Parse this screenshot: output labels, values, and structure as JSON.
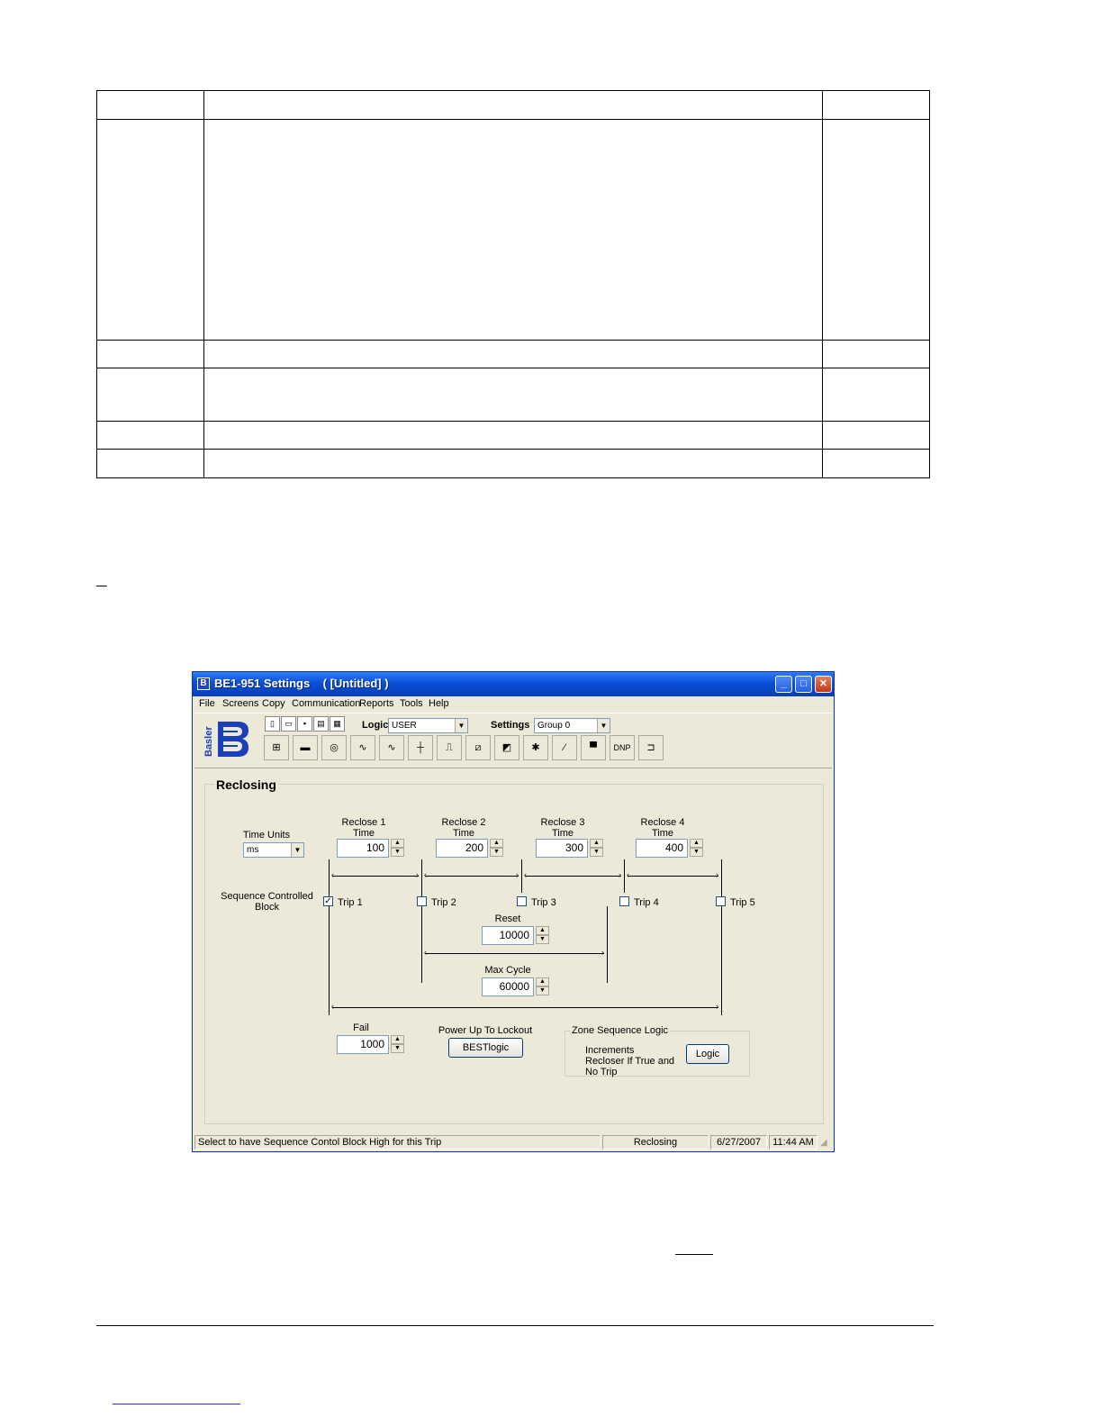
{
  "window": {
    "title": "BE1-951 Settings    ( [Untitled] )",
    "controls": {
      "minimize": "_",
      "maximize": "□",
      "close": "✕"
    }
  },
  "menu": [
    "File",
    "Screens",
    "Copy",
    "Communication",
    "Reports",
    "Tools",
    "Help"
  ],
  "toolbar": {
    "logic_label": "Logic",
    "logic_value": "USER",
    "settings_label": "Settings",
    "settings_value": "Group 0",
    "dnp_label": "DNP",
    "logo_text": "Basler"
  },
  "panel": {
    "title": "Reclosing",
    "time_units_label": "Time Units",
    "time_units_value": "ms",
    "sequence_label": "Sequence Controlled Block",
    "reclose": [
      {
        "label": "Reclose 1 Time",
        "value": "100"
      },
      {
        "label": "Reclose 2 Time",
        "value": "200"
      },
      {
        "label": "Reclose 3 Time",
        "value": "300"
      },
      {
        "label": "Reclose 4 Time",
        "value": "400"
      }
    ],
    "trips": [
      {
        "label": "Trip 1",
        "checked": true
      },
      {
        "label": "Trip 2",
        "checked": false
      },
      {
        "label": "Trip 3",
        "checked": false
      },
      {
        "label": "Trip 4",
        "checked": false
      },
      {
        "label": "Trip 5",
        "checked": false
      }
    ],
    "reset_label": "Reset",
    "reset_value": "10000",
    "max_cycle_label": "Max Cycle",
    "max_cycle_value": "60000",
    "fail_label": "Fail",
    "fail_value": "1000",
    "power_up_label": "Power Up To Lockout",
    "bestlogic_button": "BESTlogic",
    "zone_group_label": "Zone Sequence Logic",
    "zone_text": "Increments Recloser If True and No Trip",
    "logic_button": "Logic"
  },
  "status": {
    "message": "Select to have Sequence Contol Block High for this Trip",
    "screen": "Reclosing",
    "date": "6/27/2007",
    "time": "11:44 AM"
  }
}
